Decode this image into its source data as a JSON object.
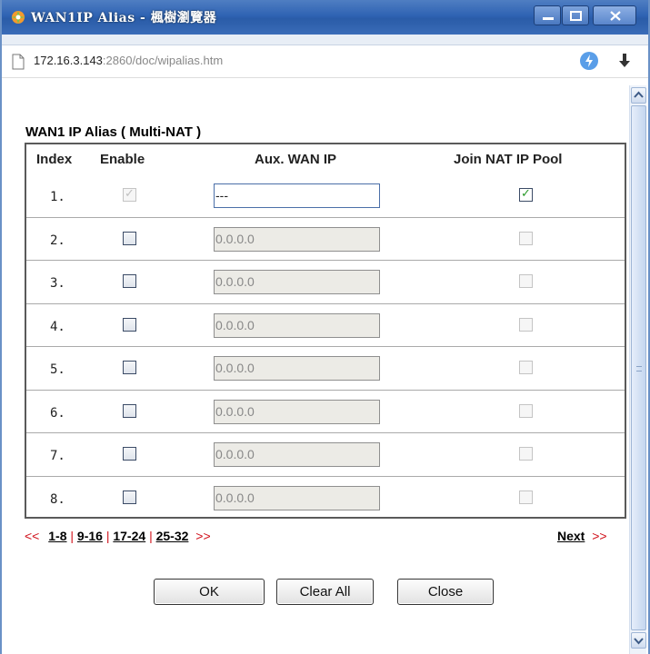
{
  "window": {
    "title": "WAN1IP Alias - 楓樹瀏覽器",
    "min_glyph": "▁",
    "max_glyph": "□",
    "close_glyph": "X",
    "accent": "#2f63b3"
  },
  "address": {
    "host": "172.16.3.143",
    "rest": ":2860/doc/wipalias.htm"
  },
  "page": {
    "heading": "WAN1 IP Alias ( Multi-NAT )",
    "columns": {
      "index": "Index",
      "enable": "Enable",
      "aux_ip": "Aux. WAN IP",
      "join_nat": "Join NAT IP Pool"
    },
    "rows": [
      {
        "index": "1.",
        "enable_checked": true,
        "enable_disabled": true,
        "ip": "---",
        "ip_editable": true,
        "join_checked": true,
        "join_disabled": false
      },
      {
        "index": "2.",
        "enable_checked": false,
        "enable_disabled": false,
        "ip": "0.0.0.0",
        "ip_editable": false,
        "join_checked": false,
        "join_disabled": true
      },
      {
        "index": "3.",
        "enable_checked": false,
        "enable_disabled": false,
        "ip": "0.0.0.0",
        "ip_editable": false,
        "join_checked": false,
        "join_disabled": true
      },
      {
        "index": "4.",
        "enable_checked": false,
        "enable_disabled": false,
        "ip": "0.0.0.0",
        "ip_editable": false,
        "join_checked": false,
        "join_disabled": true
      },
      {
        "index": "5.",
        "enable_checked": false,
        "enable_disabled": false,
        "ip": "0.0.0.0",
        "ip_editable": false,
        "join_checked": false,
        "join_disabled": true
      },
      {
        "index": "6.",
        "enable_checked": false,
        "enable_disabled": false,
        "ip": "0.0.0.0",
        "ip_editable": false,
        "join_checked": false,
        "join_disabled": true
      },
      {
        "index": "7.",
        "enable_checked": false,
        "enable_disabled": false,
        "ip": "0.0.0.0",
        "ip_editable": false,
        "join_checked": false,
        "join_disabled": true
      },
      {
        "index": "8.",
        "enable_checked": false,
        "enable_disabled": false,
        "ip": "0.0.0.0",
        "ip_editable": false,
        "join_checked": false,
        "join_disabled": true
      }
    ],
    "pager": {
      "prev": "<<",
      "links": [
        "1-8",
        "9-16",
        "17-24",
        "25-32"
      ],
      "after": ">>",
      "next_label": "Next",
      "next_arrow": ">>"
    },
    "buttons": {
      "ok": "OK",
      "clear_all": "Clear All",
      "close": "Close"
    }
  }
}
